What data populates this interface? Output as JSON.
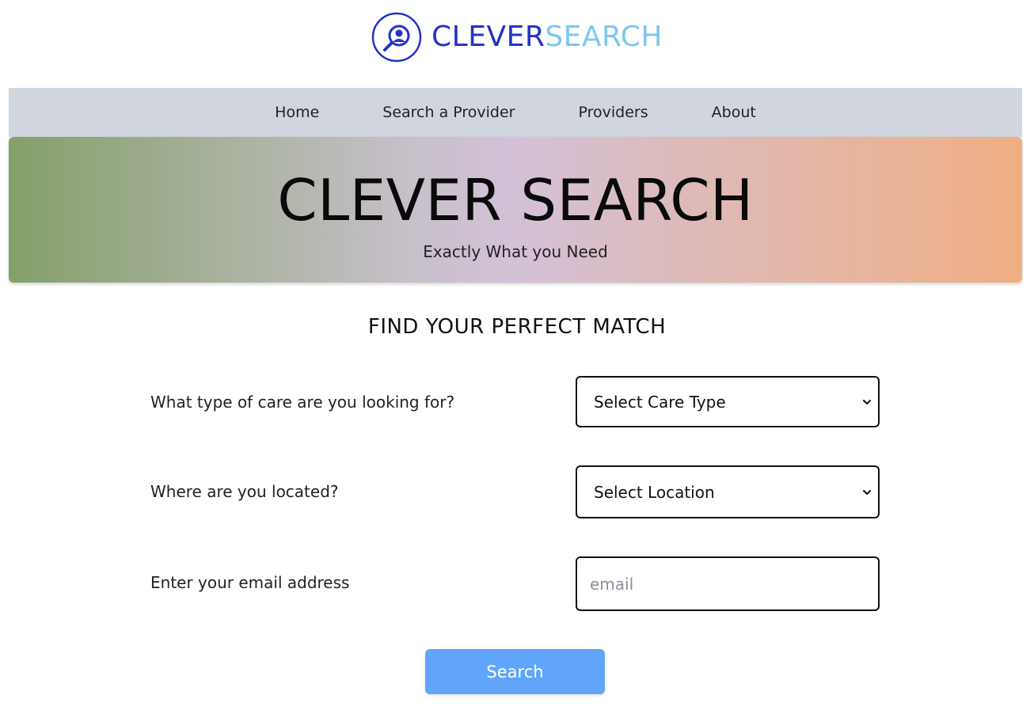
{
  "brand": {
    "name_part1": "CLEVER",
    "name_part2": "SEARCH",
    "color_primary": "#2233c4",
    "color_secondary": "#7dc8ef",
    "logo_icon": "magnifier-person-icon"
  },
  "nav": {
    "items": [
      {
        "label": "Home"
      },
      {
        "label": "Search a Provider"
      },
      {
        "label": "Providers"
      },
      {
        "label": "About"
      }
    ]
  },
  "hero": {
    "title": "CLEVER SEARCH",
    "subtitle": "Exactly What you Need"
  },
  "form": {
    "heading": "FIND YOUR PERFECT MATCH",
    "care_type": {
      "label": "What type of care are you looking for?",
      "selected": "Select Care Type"
    },
    "location": {
      "label": "Where are you located?",
      "selected": "Select Location"
    },
    "email": {
      "label": "Enter your email address",
      "value": "",
      "placeholder": "email"
    },
    "submit_label": "Search",
    "button_color": "#60a5fa"
  }
}
